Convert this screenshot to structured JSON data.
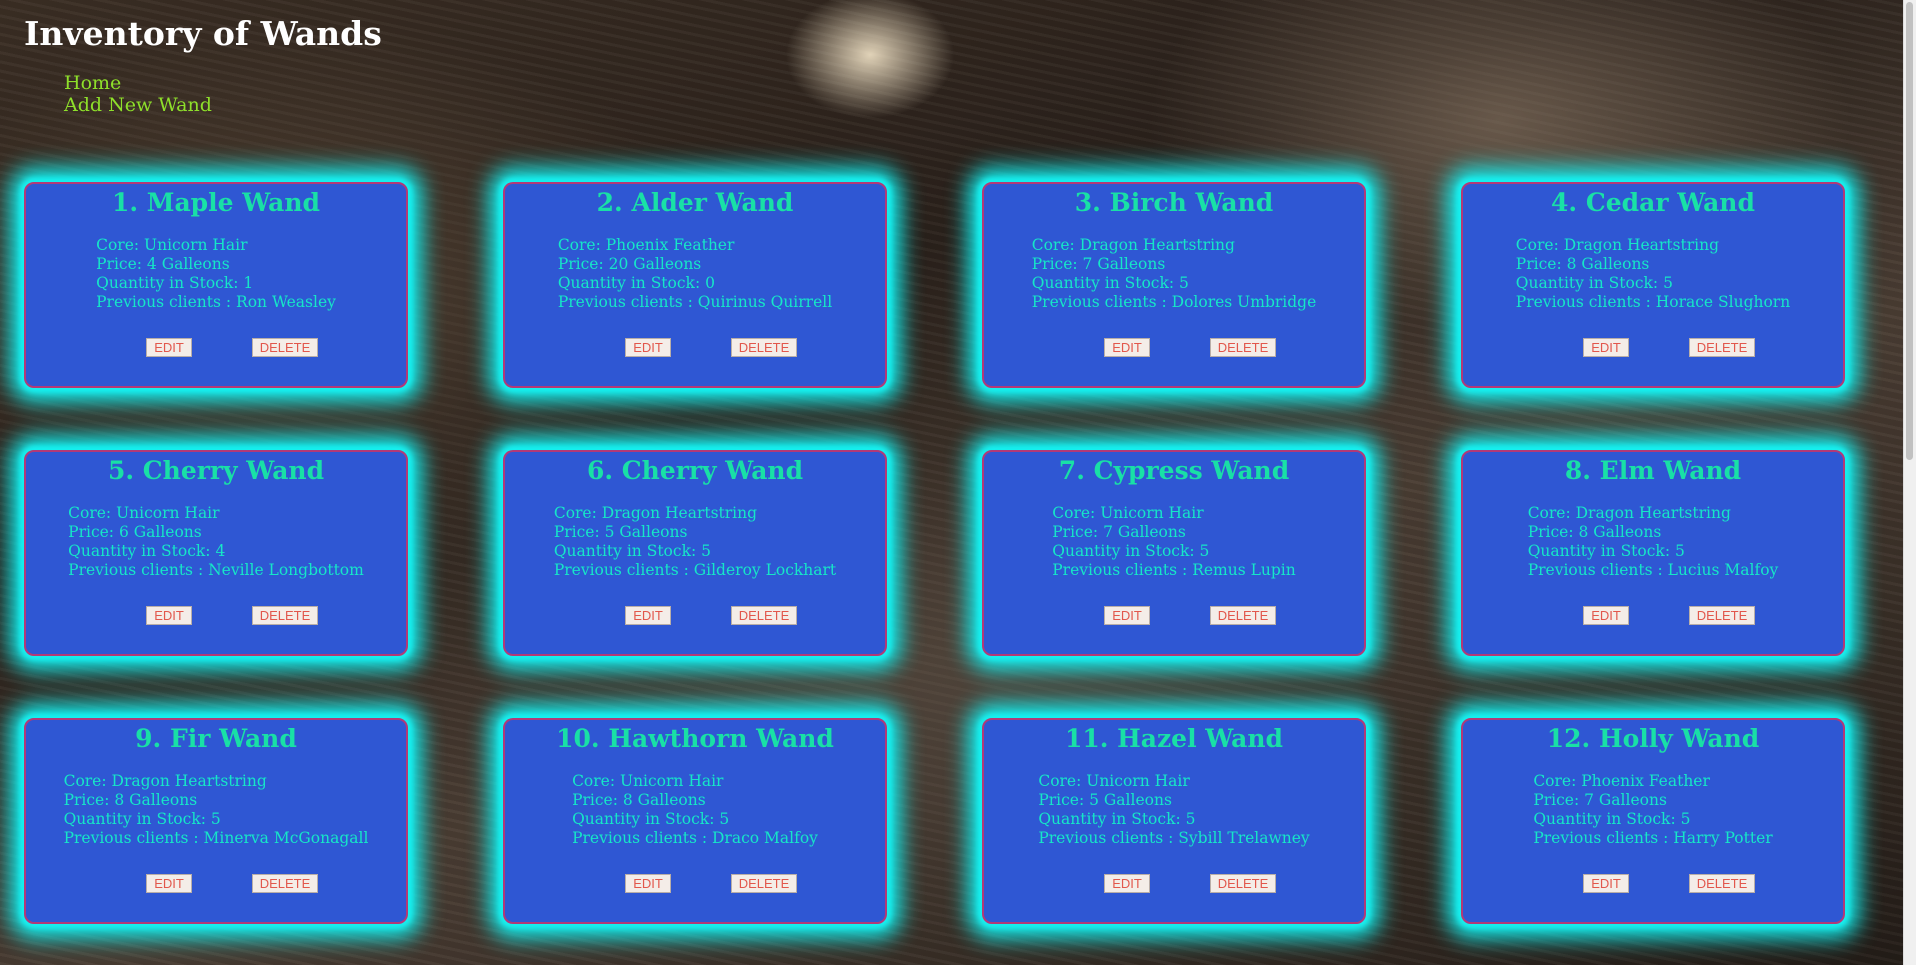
{
  "header": {
    "title": "Inventory of Wands"
  },
  "nav": {
    "home": "Home",
    "add": "Add New Wand"
  },
  "labels": {
    "core": "Core: ",
    "price": "Price: ",
    "qty": "Quantity in Stock: ",
    "clients": "Previous clients : ",
    "edit": "EDIT",
    "delete": "DELETE"
  },
  "wands": [
    {
      "title": "1. Maple Wand",
      "core": "Unicorn Hair",
      "price": "4 Galleons",
      "qty": "1",
      "clients": "Ron Weasley"
    },
    {
      "title": "2. Alder Wand",
      "core": "Phoenix Feather",
      "price": "20 Galleons",
      "qty": "0",
      "clients": "Quirinus Quirrell"
    },
    {
      "title": "3. Birch Wand",
      "core": "Dragon Heartstring",
      "price": "7 Galleons",
      "qty": "5",
      "clients": "Dolores Umbridge"
    },
    {
      "title": "4. Cedar Wand",
      "core": "Dragon Heartstring",
      "price": "8 Galleons",
      "qty": "5",
      "clients": "Horace Slughorn"
    },
    {
      "title": "5. Cherry Wand",
      "core": "Unicorn Hair",
      "price": "6 Galleons",
      "qty": "4",
      "clients": "Neville Longbottom"
    },
    {
      "title": "6. Cherry Wand",
      "core": "Dragon Heartstring",
      "price": "5 Galleons",
      "qty": "5",
      "clients": "Gilderoy Lockhart"
    },
    {
      "title": "7. Cypress Wand",
      "core": "Unicorn Hair",
      "price": "7 Galleons",
      "qty": "5",
      "clients": "Remus Lupin"
    },
    {
      "title": "8. Elm Wand",
      "core": "Dragon Heartstring",
      "price": "8 Galleons",
      "qty": "5",
      "clients": "Lucius Malfoy"
    },
    {
      "title": "9. Fir Wand",
      "core": "Dragon Heartstring",
      "price": "8 Galleons",
      "qty": "5",
      "clients": "Minerva McGonagall"
    },
    {
      "title": "10. Hawthorn Wand",
      "core": "Unicorn Hair",
      "price": "8 Galleons",
      "qty": "5",
      "clients": "Draco Malfoy"
    },
    {
      "title": "11. Hazel Wand",
      "core": "Unicorn Hair",
      "price": "5 Galleons",
      "qty": "5",
      "clients": "Sybill Trelawney"
    },
    {
      "title": "12. Holly Wand",
      "core": "Phoenix Feather",
      "price": "7 Galleons",
      "qty": "5",
      "clients": "Harry Potter"
    }
  ]
}
